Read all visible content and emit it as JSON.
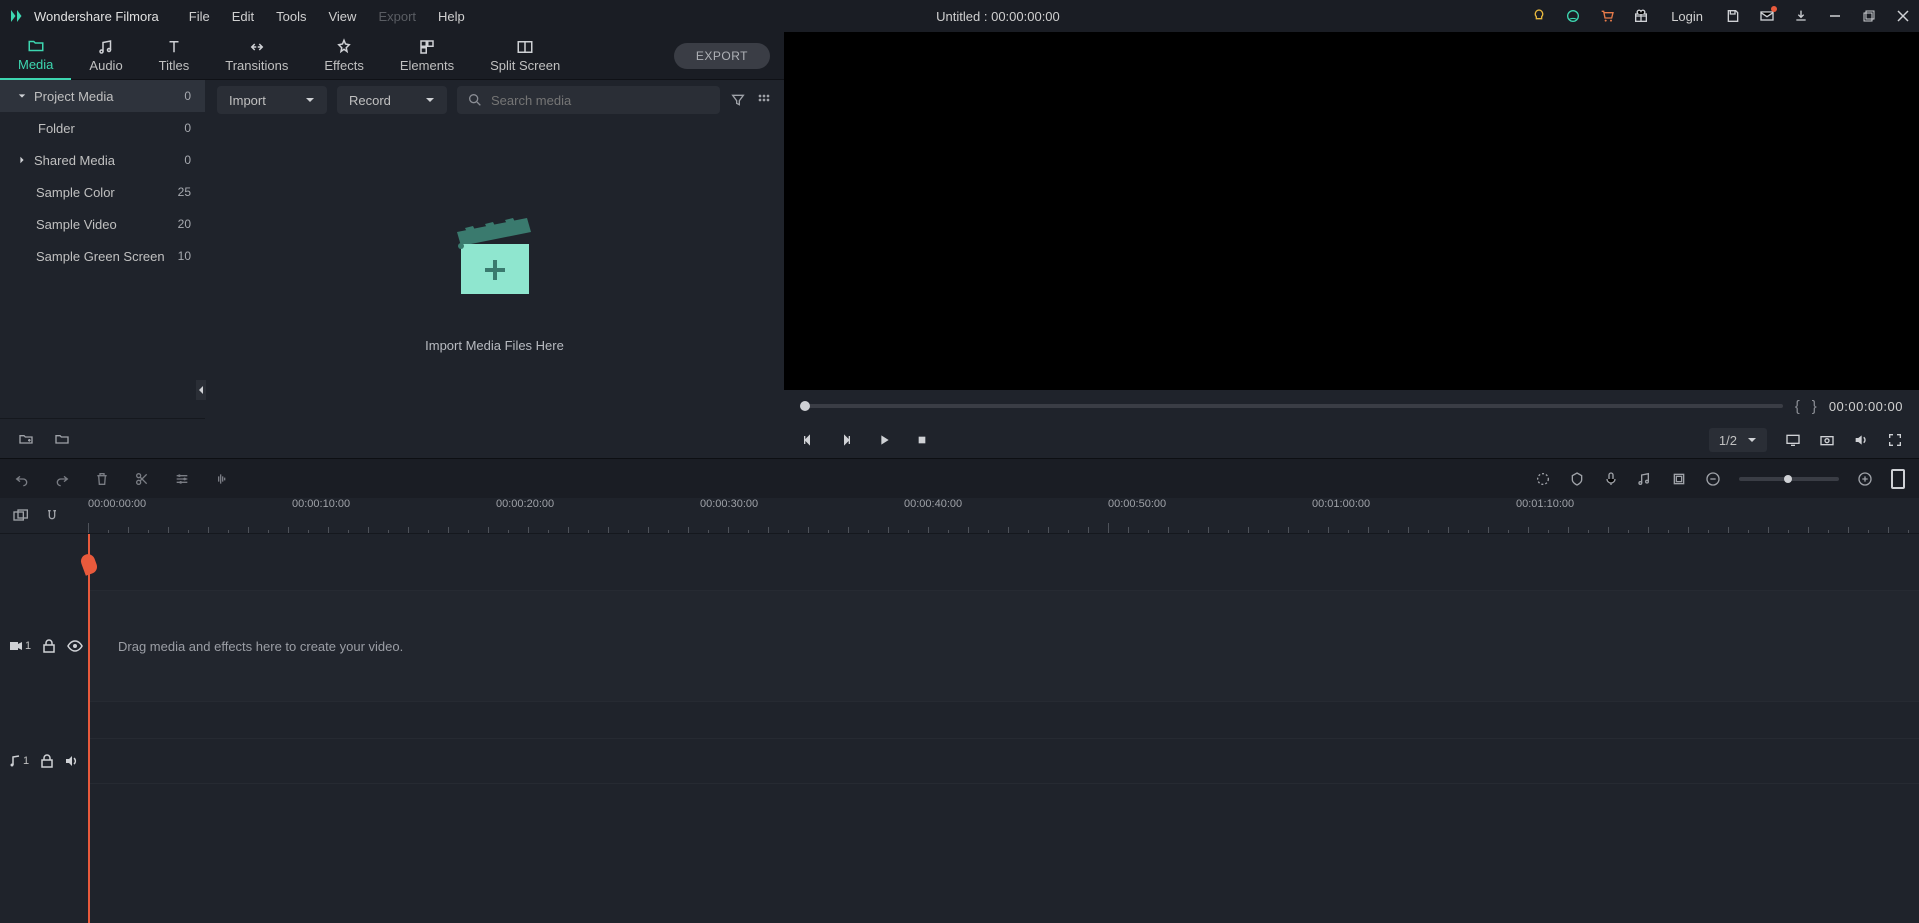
{
  "app": {
    "name": "Wondershare Filmora"
  },
  "menu": {
    "file": "File",
    "edit": "Edit",
    "tools": "Tools",
    "view": "View",
    "export": "Export",
    "help": "Help"
  },
  "title": "Untitled : 00:00:00:00",
  "login": "Login",
  "tabs": {
    "media": "Media",
    "audio": "Audio",
    "titles": "Titles",
    "transitions": "Transitions",
    "effects": "Effects",
    "elements": "Elements",
    "split": "Split Screen"
  },
  "export_btn": "EXPORT",
  "sidebar": {
    "project": {
      "label": "Project Media",
      "count": "0"
    },
    "folder": {
      "label": "Folder",
      "count": "0"
    },
    "shared": {
      "label": "Shared Media",
      "count": "0"
    },
    "color": {
      "label": "Sample Color",
      "count": "25"
    },
    "video": {
      "label": "Sample Video",
      "count": "20"
    },
    "green": {
      "label": "Sample Green Screen",
      "count": "10"
    }
  },
  "media": {
    "import": "Import",
    "record": "Record",
    "search_ph": "Search media",
    "drop": "Import Media Files Here"
  },
  "preview": {
    "ratio": "1/2",
    "timecode": "00:00:00:00"
  },
  "timeline": {
    "ticks": [
      "00:00:00:00",
      "00:00:10:00",
      "00:00:20:00",
      "00:00:30:00",
      "00:00:40:00",
      "00:00:50:00",
      "00:01:00:00",
      "00:01:10:00"
    ],
    "drop": "Drag media and effects here to create your video.",
    "v1": "1",
    "a1": "1"
  }
}
